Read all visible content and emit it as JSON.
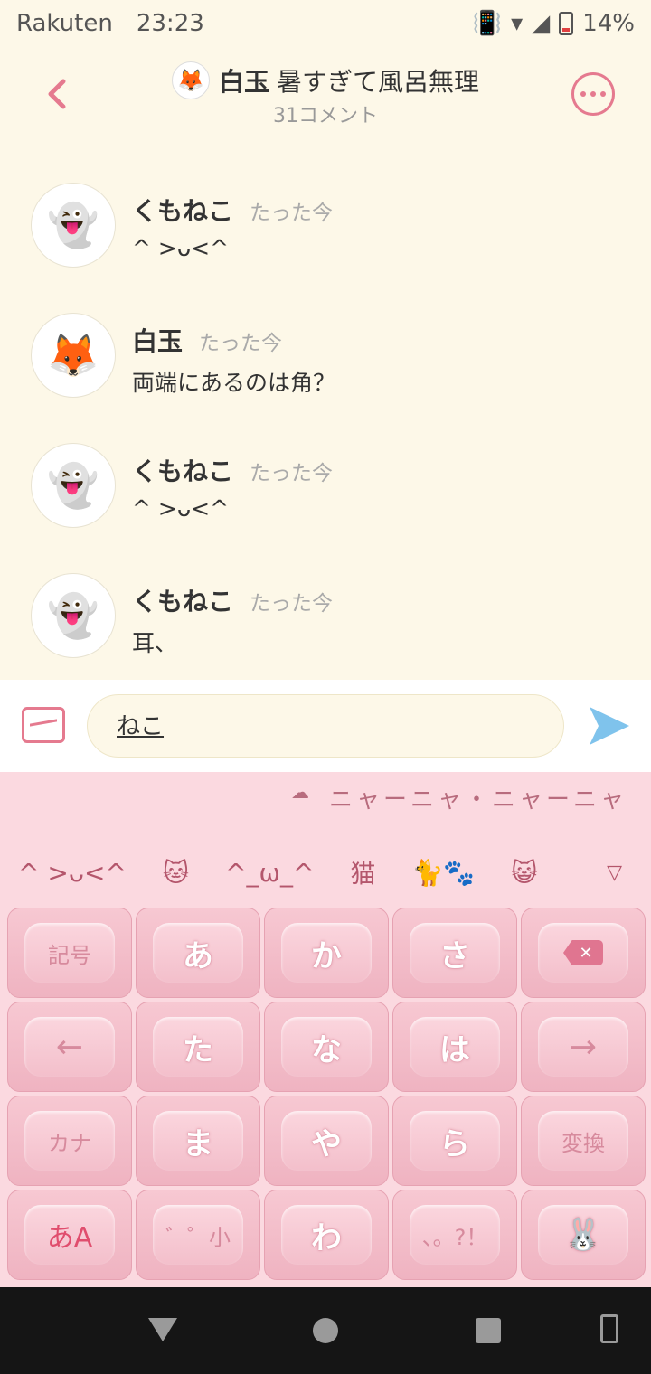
{
  "status": {
    "carrier": "Rakuten",
    "time": "23:23",
    "battery": "14%",
    "battery_fraction": 0.14
  },
  "header": {
    "back_icon": "chevron-left-icon",
    "author": "白玉",
    "thread_title": "暑すぎて風呂無理",
    "comment_count": "31コメント",
    "more_icon": "ellipsis-icon"
  },
  "comments": [
    {
      "name": "くもねこ",
      "time": "たった今",
      "body": "^ >ᴗ<^",
      "avatar": "mimikyu-avatar"
    },
    {
      "name": "白玉",
      "time": "たった今",
      "body": "両端にあるのは角？",
      "avatar": "eevee-avatar"
    },
    {
      "name": "くもねこ",
      "time": "たった今",
      "body": "^ >ᴗ<^",
      "avatar": "mimikyu-avatar"
    },
    {
      "name": "くもねこ",
      "time": "たった今",
      "body": "耳、",
      "avatar": "mimikyu-avatar"
    }
  ],
  "input": {
    "value": "ねこ"
  },
  "keyboard": {
    "top_suggestion": "ニャーニャ・ニャーニャ",
    "candidates": [
      "^ >ᴗ<^",
      "🐱",
      "^_ω_^",
      "猫",
      "🐈🐾",
      "😺"
    ],
    "keys": {
      "symbol": "記号",
      "a": "あ",
      "ka": "か",
      "sa": "さ",
      "delete": "✕",
      "left": "←",
      "ta": "た",
      "na": "な",
      "ha": "は",
      "right": "→",
      "kana": "カナ",
      "ma": "ま",
      "ya": "や",
      "ra": "ら",
      "convert": "変換",
      "mode": "あA",
      "small": "゛゜小",
      "wa": "わ",
      "punct": "、。?！"
    }
  },
  "colors": {
    "accent": "#e57a8f",
    "background": "#fdf8e8",
    "keyboard": "#fbd9e0",
    "send": "#7fc3ec"
  }
}
